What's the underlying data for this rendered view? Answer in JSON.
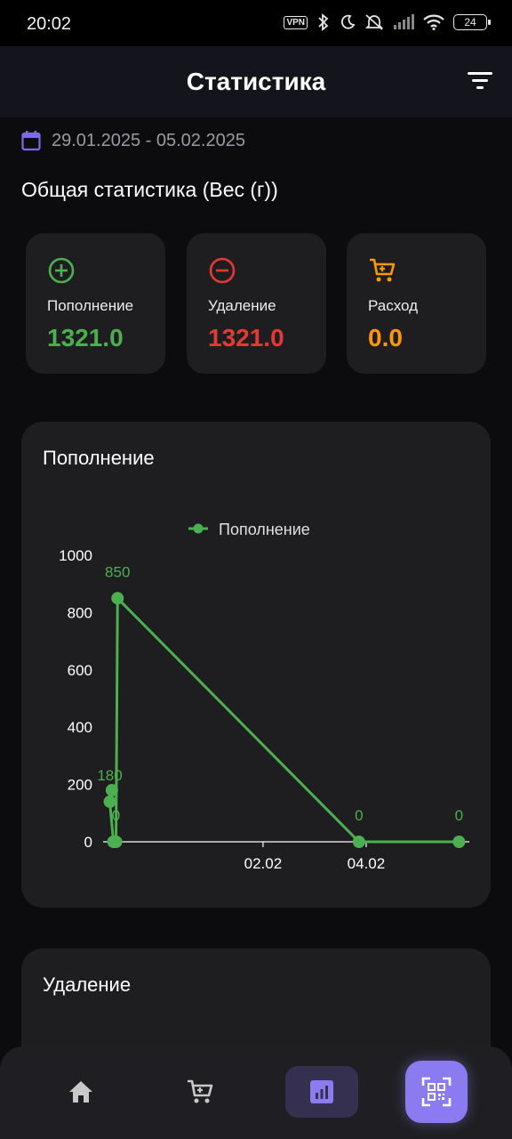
{
  "status_bar": {
    "time": "20:02",
    "vpn": "VPN",
    "battery": "24"
  },
  "header": {
    "title": "Статистика",
    "filter_icon": "filter-icon"
  },
  "date_range": {
    "icon": "calendar-icon",
    "text": "29.01.2025 - 05.02.2025"
  },
  "summary_title": "Общая статистика (Вес (г))",
  "stats": [
    {
      "icon": "add-circle-icon",
      "label": "Пополнение",
      "value": "1321.0",
      "color": "#4caf50"
    },
    {
      "icon": "remove-circle-icon",
      "label": "Удаление",
      "value": "1321.0",
      "color": "#e53935"
    },
    {
      "icon": "cart-icon",
      "label": "Расход",
      "value": "0.0",
      "color": "#ff9800"
    }
  ],
  "charts": [
    {
      "title": "Пополнение"
    },
    {
      "title": "Удаление"
    }
  ],
  "chart_data": {
    "type": "line",
    "legend": [
      "Пополнение"
    ],
    "legend_position": "top-center",
    "x_tick_labels": [
      "02.02",
      "04.02"
    ],
    "y_tick_labels": [
      "0",
      "200",
      "400",
      "600",
      "800",
      "1000"
    ],
    "ylim": [
      0,
      1000
    ],
    "series": [
      {
        "name": "Пополнение",
        "color": "#4caf50",
        "x": [
          -0.93,
          -0.97,
          -0.9,
          -0.85,
          -0.82,
          3.86,
          5.8
        ],
        "y": [
          180,
          140,
          0,
          0,
          850,
          0,
          0
        ],
        "labels": [
          "",
          "180",
          "",
          "0",
          "850",
          "0",
          "0"
        ]
      }
    ],
    "x_ticks_value": [
      2,
      4
    ],
    "xlim": [
      -1.1,
      6.0
    ]
  },
  "bottom_nav": {
    "items": [
      {
        "icon": "home-icon",
        "active": false
      },
      {
        "icon": "cart-icon",
        "active": false
      },
      {
        "icon": "bar-chart-icon",
        "active": true
      },
      {
        "icon": "qr-scan-icon",
        "active": false
      }
    ]
  },
  "colors": {
    "accent": "#8a7cf0",
    "card": "#1e1e20",
    "background": "#0c0c0e"
  }
}
